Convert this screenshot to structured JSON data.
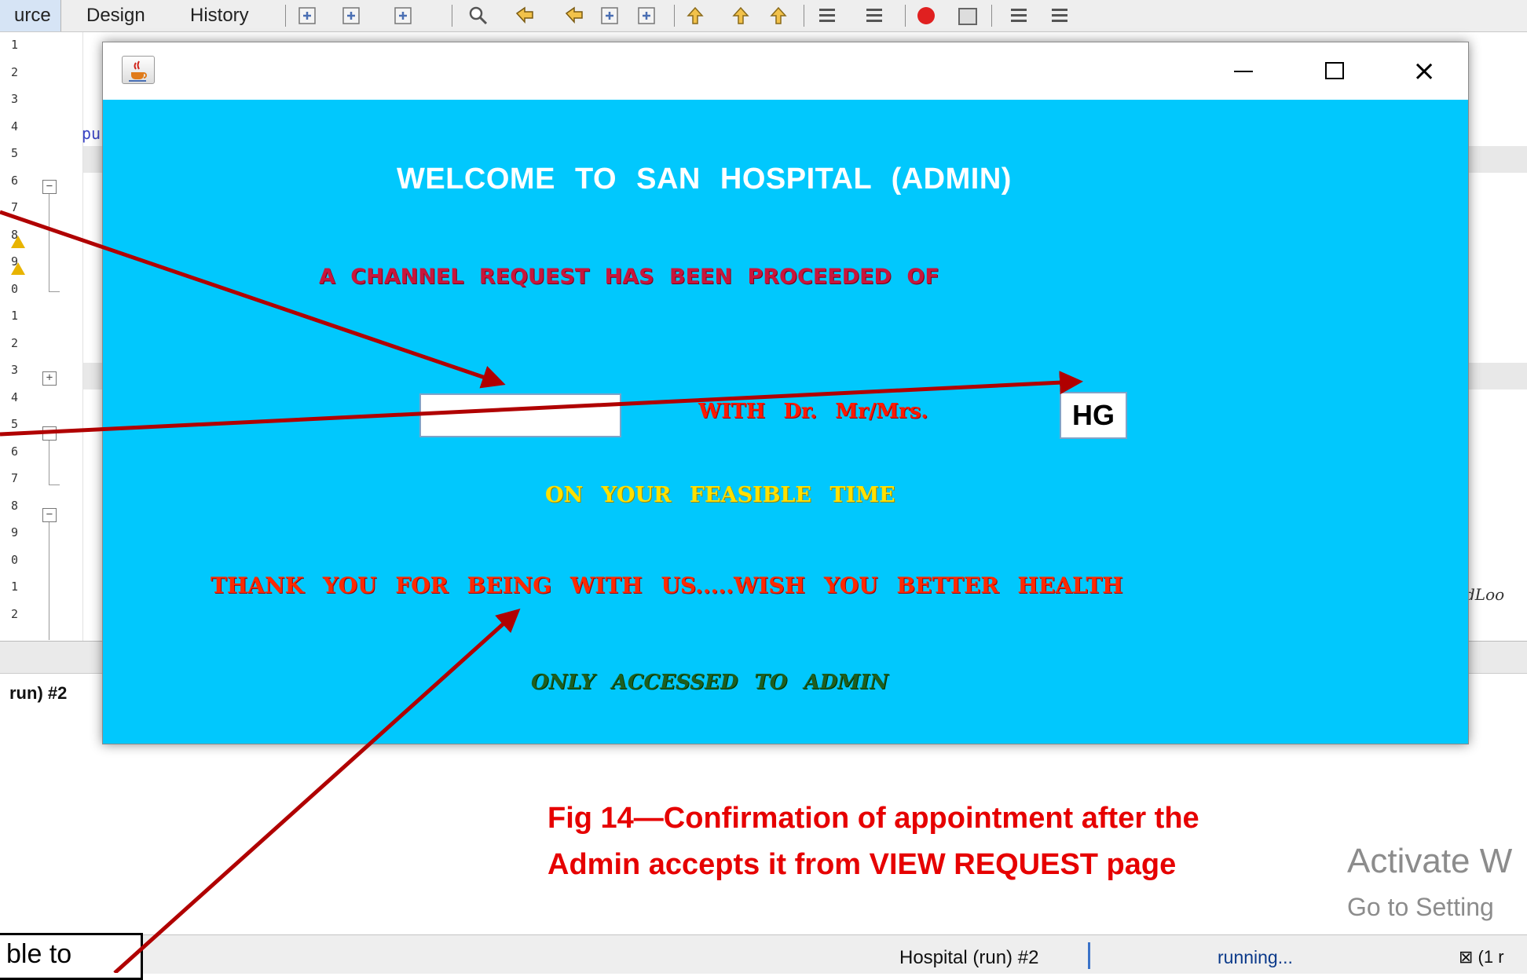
{
  "ide": {
    "tabs": [
      "urce",
      "Design",
      "History"
    ],
    "line_numbers": [
      "1",
      "2",
      "3",
      "4",
      "5",
      "6",
      "7",
      "8",
      "9",
      "0",
      "1",
      "2",
      "3",
      "4",
      "5",
      "6",
      "7",
      "8",
      "9",
      "0",
      "1",
      "2"
    ],
    "code_fragment": "pu",
    "right_fragment": "dLoo",
    "run_tab": "run) #2",
    "toolbar_icons": [
      "back-icon",
      "forward-dropdown-icon",
      "history-dropdown-icon",
      "find-icon",
      "find-previous-icon",
      "find-next-icon",
      "toggle-highlight-icon",
      "select-rectangle-icon",
      "previous-bookmark-icon",
      "next-bookmark-icon",
      "toggle-bookmark-icon",
      "shift-left-icon",
      "shift-right-icon",
      "record-macro-icon",
      "stop-macro-icon",
      "comment-icon",
      "uncomment-icon"
    ],
    "accent_color": "#3b73c8"
  },
  "dialog": {
    "title_icon": "java-coffee-icon",
    "controls": {
      "minimize": "minimize-icon",
      "maximize": "maximize-icon",
      "close": "×"
    },
    "background_color": "#01c8fd",
    "welcome": "WELCOME   TO   SAN   HOSPITAL (ADMIN)",
    "channel_request": "A  CHANNEL  REQUEST  HAS BEEN   PROCEEDED   OF",
    "patient_value": "",
    "with_doctor": "WITH   Dr.  Mr/Mrs.",
    "doctor_value": "HG",
    "feasible_time": "ON  YOUR  FEASIBLE   TIME",
    "thank_you": "THANK  YOU  FOR  BEING   WITH   US.....WISH  YOU  BETTER  HEALTH",
    "admin_only": "ONLY  ACCESSED  TO  ADMIN"
  },
  "caption": {
    "line1": "Fig 14—Confirmation of appointment after the",
    "line2": "Admin accepts it from VIEW REQUEST page",
    "color": "#e60000"
  },
  "watermark": {
    "line1": "Activate W",
    "line2": "Go to Setting"
  },
  "status": {
    "task": "Hospital (run) #2",
    "progress_text": "running...",
    "right": "⊠ (1 r"
  },
  "callout": {
    "text": "ble to"
  },
  "annotation": {
    "arrow_color": "#b00000"
  }
}
